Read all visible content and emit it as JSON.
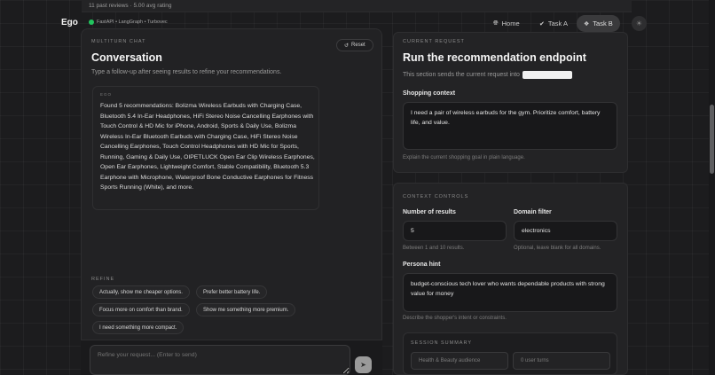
{
  "top": {
    "reviews": "11 past reviews · 5.00 avg rating"
  },
  "nav": {
    "logo": "Ego",
    "stack": "FastAPI • LangGraph • Turbovec",
    "items": [
      {
        "label": "Home",
        "icon": "globe-icon"
      },
      {
        "label": "Task A",
        "icon": "check-circle-icon"
      },
      {
        "label": "Task B",
        "icon": "tag-icon",
        "active": true
      }
    ],
    "theme_icon": "sun-icon"
  },
  "chat": {
    "kicker": "MULTITURN CHAT",
    "title": "Conversation",
    "subtitle": "Type a follow-up after seeing results to refine your recommendations.",
    "reset_label": "Reset",
    "message": {
      "sender": "EGO",
      "text": "Found 5 recommendations: Bolizma Wireless Earbuds with Charging Case, Bluetooth 5.4 In-Ear Headphones, HiFi Stereo Noise Cancelling Earphones with Touch Control & HD Mic for iPhone, Android, Sports & Daily Use, Bolizma Wireless In-Ear Bluetooth Earbuds with Charging Case, HiFi Stereo Noise Cancelling Earphones, Touch Control Headphones with HD Mic for Sports, Running, Gaming & Daily Use, OIPETLUCK Open Ear Clip Wireless Earphones, Open Ear Earphones, Lightweight Comfort, Stable Compatibility, Bluetooth 5.3 Earphone with Microphone, Waterproof Bone Conductive Earphones for Fitness Sports Running (White), and more."
    },
    "refine_kicker": "REFINE",
    "chips": [
      "Actually, show me cheaper options.",
      "Prefer better battery life.",
      "Focus more on comfort than brand.",
      "Show me something more premium.",
      "I need something more compact."
    ],
    "composer_placeholder": "Refine your request... (Enter to send)"
  },
  "request": {
    "kicker": "CURRENT REQUEST",
    "title": "Run the recommendation endpoint",
    "subtitle": "This section sends the current request into",
    "shopping_label": "Shopping context",
    "shopping_value": "I need a pair of wireless earbuds for the gym. Prioritize comfort, battery life, and value.",
    "shopping_hint": "Explain the current shopping goal in plain language."
  },
  "controls": {
    "kicker": "CONTEXT CONTROLS",
    "num_results_label": "Number of results",
    "num_results_value": "5",
    "num_results_hint": "Between 1 and 10 results.",
    "domain_label": "Domain filter",
    "domain_value": "electronics",
    "domain_hint": "Optional, leave blank for all domains.",
    "persona_label": "Persona hint",
    "persona_value": "budget-conscious tech lover who wants dependable products with strong value for money",
    "persona_hint": "Describe the shopper's intent or constraints.",
    "summary": {
      "kicker": "SESSION SUMMARY",
      "field1": "Health & Beauty audience",
      "field2": "0 user turns"
    }
  }
}
